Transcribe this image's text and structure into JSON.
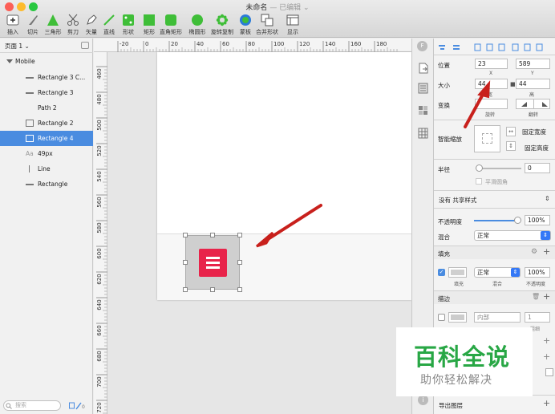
{
  "window": {
    "title": "未命名",
    "subtitle": "— 已编辑 ⌄"
  },
  "toolbar": {
    "tools": [
      {
        "name": "insert",
        "label": "插入"
      },
      {
        "name": "slice",
        "label": "切片"
      },
      {
        "name": "triangle",
        "label": "三角形"
      },
      {
        "name": "scissors",
        "label": "剪刀"
      },
      {
        "name": "vector",
        "label": "矢量"
      },
      {
        "name": "line",
        "label": "直线"
      },
      {
        "name": "shape",
        "label": "形状"
      },
      {
        "name": "rectangle",
        "label": "矩形"
      },
      {
        "name": "rounded-rect",
        "label": "直角矩形"
      },
      {
        "name": "oval",
        "label": "椭圆形"
      },
      {
        "name": "rotate-copy",
        "label": "旋转复制"
      },
      {
        "name": "mask",
        "label": "蒙板"
      },
      {
        "name": "combine",
        "label": "合并形状"
      },
      {
        "name": "display",
        "label": "显示"
      }
    ]
  },
  "sidebar": {
    "page": "页面 1 ⌄",
    "root": "Mobile",
    "search_placeholder": "搜索",
    "layers": [
      {
        "label": "Rectangle 3 C...",
        "icon": "line-icon",
        "selected": false
      },
      {
        "label": "Rectangle 3",
        "icon": "line-icon",
        "selected": false
      },
      {
        "label": "Path 2",
        "icon": "none",
        "selected": false
      },
      {
        "label": "Rectangle 2",
        "icon": "square-icon",
        "selected": false
      },
      {
        "label": "Rectangle 4",
        "icon": "square-icon",
        "selected": true
      },
      {
        "label": "49px",
        "icon": "text-icon",
        "selected": false
      },
      {
        "label": "Line",
        "icon": "vline-icon",
        "selected": false
      },
      {
        "label": "Rectangle",
        "icon": "line-icon",
        "selected": false
      }
    ]
  },
  "rulers": {
    "top": [
      "-20",
      "0",
      "20",
      "40",
      "60",
      "80",
      "100",
      "120",
      "140",
      "160",
      "180"
    ],
    "left": [
      "460",
      "480",
      "500",
      "520",
      "540",
      "560",
      "580",
      "600",
      "620",
      "640",
      "660",
      "680",
      "700",
      "720"
    ]
  },
  "inspector": {
    "position": {
      "label": "位置",
      "x": "23",
      "y": "589",
      "x_sub": "X",
      "y_sub": "Y"
    },
    "size": {
      "label": "大小",
      "w": "44",
      "h": "44",
      "w_sub": "宽",
      "h_sub": "高"
    },
    "transform": {
      "label": "变换",
      "rotate_sub": "旋转",
      "flip_sub": "翻转"
    },
    "resizing": {
      "label": "智能缩放",
      "fix_width": "固定宽度",
      "fix_height": "固定高度"
    },
    "radius": {
      "label": "半径",
      "value": "0",
      "smooth": "平滑圆角",
      "slider": 0.0
    },
    "shared_style": "没有 共享样式",
    "opacity": {
      "label": "不透明度",
      "value": "100%",
      "slider": 1.0
    },
    "blending": {
      "label": "混合",
      "value": "正常"
    },
    "fill": {
      "label": "填充",
      "mode": "正常",
      "opacity": "100%",
      "sub_fill": "填充",
      "sub_blend": "混合",
      "sub_opacity": "不透明度"
    },
    "border": {
      "label": "描边",
      "position": "内部",
      "width": "1",
      "sub_width": "粗细"
    },
    "export": "导出图层"
  },
  "watermark": {
    "main": "百科全说",
    "sub": "助你轻松解决"
  },
  "colors": {
    "accent": "#4a8ce0",
    "red": "#e8234a",
    "gray": "#cfcfcf",
    "arrow": "#c8201c",
    "green": "#3fbe38"
  }
}
